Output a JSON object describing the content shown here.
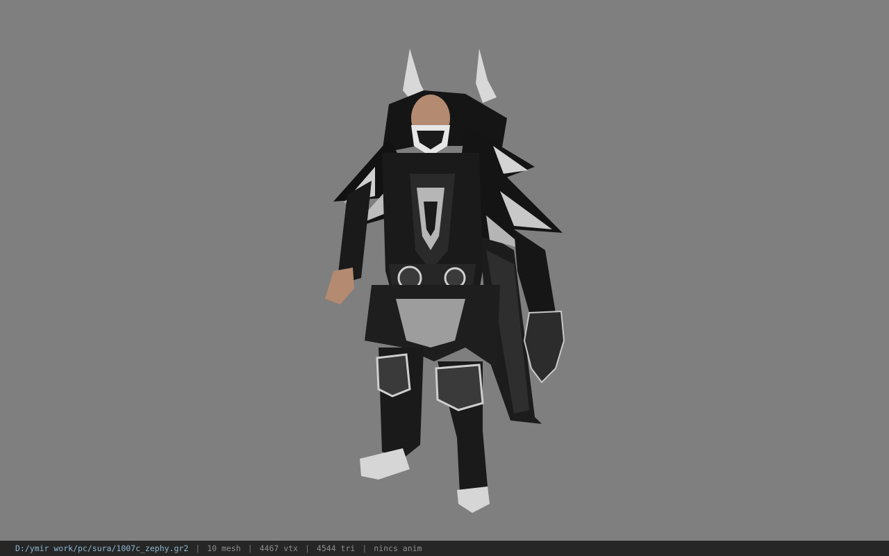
{
  "viewer": {
    "background_color": "#7f7f7f",
    "model_name": "armored-character-model"
  },
  "statusbar": {
    "file_path": "D:/ymir work/pc/sura/1007c_zephy.gr2",
    "separator": "|",
    "mesh_count": "10 mesh",
    "vertex_count": "4467 vtx",
    "triangle_count": "4544 tri",
    "animation": "nincs anim"
  }
}
